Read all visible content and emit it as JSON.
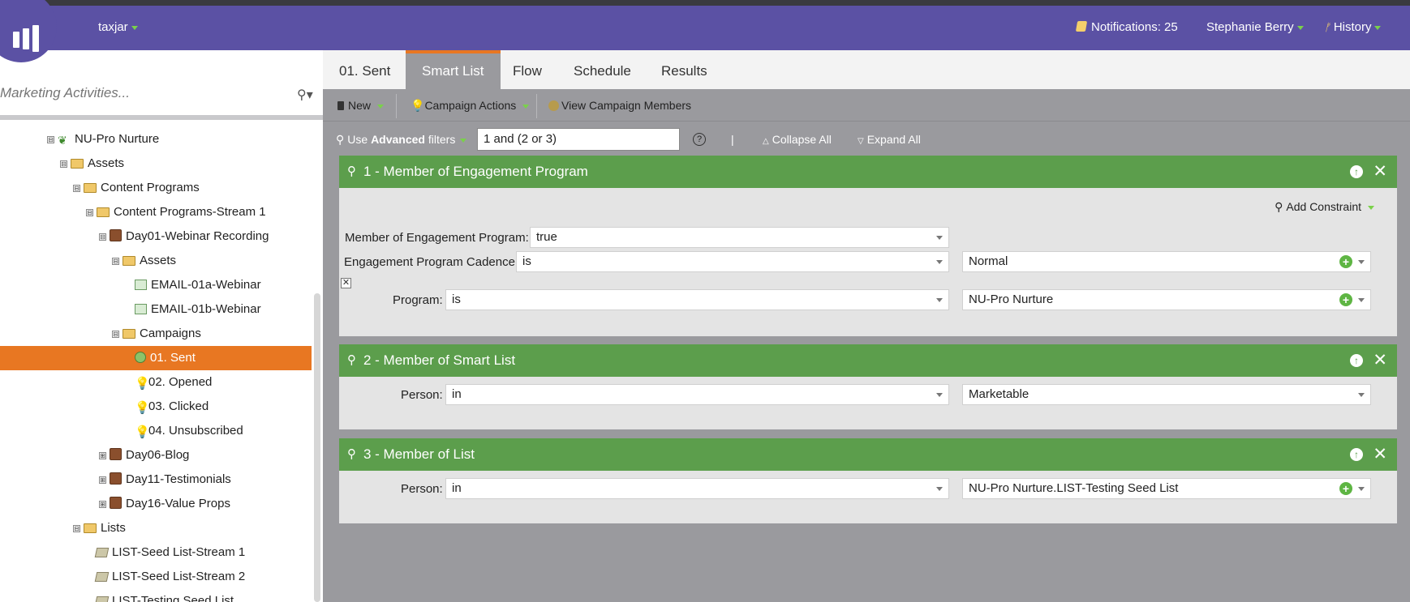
{
  "header": {
    "workspace": "taxjar",
    "notifications": "Notifications: 25",
    "user": "Stephanie Berry",
    "history": "History"
  },
  "left": {
    "search_placeholder": "Marketing Activities...",
    "tree": [
      {
        "label": "NU-Pro Nurture",
        "icon": "program-tree-icon",
        "toggle": "⊟"
      },
      {
        "label": "Assets",
        "icon": "folder-icon",
        "toggle": "⊟"
      },
      {
        "label": "Content Programs",
        "icon": "folder-icon",
        "toggle": "⊟"
      },
      {
        "label": "Content Programs-Stream 1",
        "icon": "folder-icon",
        "toggle": "⊟"
      },
      {
        "label": "Day01-Webinar Recording",
        "icon": "program-icon",
        "toggle": "⊟"
      },
      {
        "label": "Assets",
        "icon": "folder-icon",
        "toggle": "⊟"
      },
      {
        "label": "EMAIL-01a-Webinar",
        "icon": "email-icon",
        "toggle": ""
      },
      {
        "label": "EMAIL-01b-Webinar",
        "icon": "email-icon",
        "toggle": ""
      },
      {
        "label": "Campaigns",
        "icon": "folder-icon",
        "toggle": "⊟"
      },
      {
        "label": "01. Sent",
        "icon": "campaign-active-icon",
        "toggle": "",
        "selected": true
      },
      {
        "label": "02. Opened",
        "icon": "lightbulb-icon",
        "toggle": ""
      },
      {
        "label": "03. Clicked",
        "icon": "lightbulb-icon",
        "toggle": ""
      },
      {
        "label": "04. Unsubscribed",
        "icon": "lightbulb-icon",
        "toggle": ""
      },
      {
        "label": "Day06-Blog",
        "icon": "program-icon",
        "toggle": "⊞"
      },
      {
        "label": "Day11-Testimonials",
        "icon": "program-icon",
        "toggle": "⊞"
      },
      {
        "label": "Day16-Value Props",
        "icon": "program-icon",
        "toggle": "⊞"
      },
      {
        "label": "Lists",
        "icon": "folder-icon",
        "toggle": "⊟"
      },
      {
        "label": "LIST-Seed List-Stream 1",
        "icon": "list-icon",
        "toggle": ""
      },
      {
        "label": "LIST-Seed List-Stream 2",
        "icon": "list-icon",
        "toggle": ""
      },
      {
        "label": "LIST-Testing Seed List",
        "icon": "list-icon",
        "toggle": ""
      }
    ]
  },
  "tabs": [
    "01. Sent",
    "Smart List",
    "Flow",
    "Schedule",
    "Results"
  ],
  "toolbar": {
    "new": "New",
    "campaign_actions": "Campaign Actions",
    "view_members": "View Campaign Members"
  },
  "filterbar": {
    "use": "Use",
    "advanced": "Advanced",
    "filters": "filters",
    "logic": "1 and (2 or 3)",
    "help": "?",
    "sep": "|",
    "collapse": "Collapse All",
    "expand": "Expand All"
  },
  "filters": [
    {
      "title": "1 - Member of Engagement Program",
      "add_constraint": "Add Constraint",
      "rows": [
        {
          "label": "Member of Engagement Program:",
          "operator": "true"
        },
        {
          "label": "Engagement Program Cadence:",
          "operator": "is",
          "value": "Normal"
        },
        {
          "label": "Program:",
          "operator": "is",
          "value": "NU-Pro Nurture"
        }
      ]
    },
    {
      "title": "2 - Member of Smart List",
      "rows": [
        {
          "label": "Person:",
          "operator": "in",
          "value": "Marketable"
        }
      ]
    },
    {
      "title": "3 - Member of List",
      "rows": [
        {
          "label": "Person:",
          "operator": "in",
          "value": "NU-Pro Nurture.LIST-Testing Seed List"
        }
      ]
    }
  ],
  "colors": {
    "header": "#5b51a4",
    "accent": "#e87722",
    "filter_header": "#5c9e4c",
    "toolbar": "#9a9a9e"
  }
}
